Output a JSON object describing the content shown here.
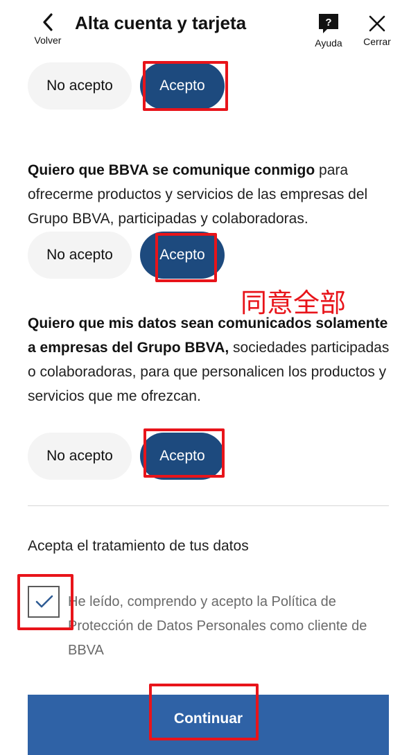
{
  "header": {
    "back_label": "Volver",
    "title": "Alta cuenta y tarjeta",
    "help_label": "Ayuda",
    "close_label": "Cerrar"
  },
  "choice_buttons": {
    "decline_label": "No acepto",
    "accept_label": "Acepto"
  },
  "sections": [
    {
      "bold": "Quiero que BBVA se comunique conmigo",
      "text": " para ofrecerme productos y servicios de las empresas del Grupo BBVA, participadas y colaboradoras."
    },
    {
      "bold": "Quiero que mis datos sean comunicados solamente a empresas del Grupo BBVA,",
      "text": " sociedades participadas o colaboradoras, para que personalicen los productos y servicios que me ofrezcan."
    }
  ],
  "consent": {
    "title": "Acepta el tratamiento de tus datos",
    "checked": true,
    "text": "He leído, comprendo y acepto la Política de Protección de Datos Personales como cliente de BBVA"
  },
  "cta_label": "Continuar",
  "annotation_note": "同意全部",
  "colors": {
    "accent": "#1d4a7e",
    "cta": "#2f62a6",
    "annotation": "#e8141a"
  }
}
